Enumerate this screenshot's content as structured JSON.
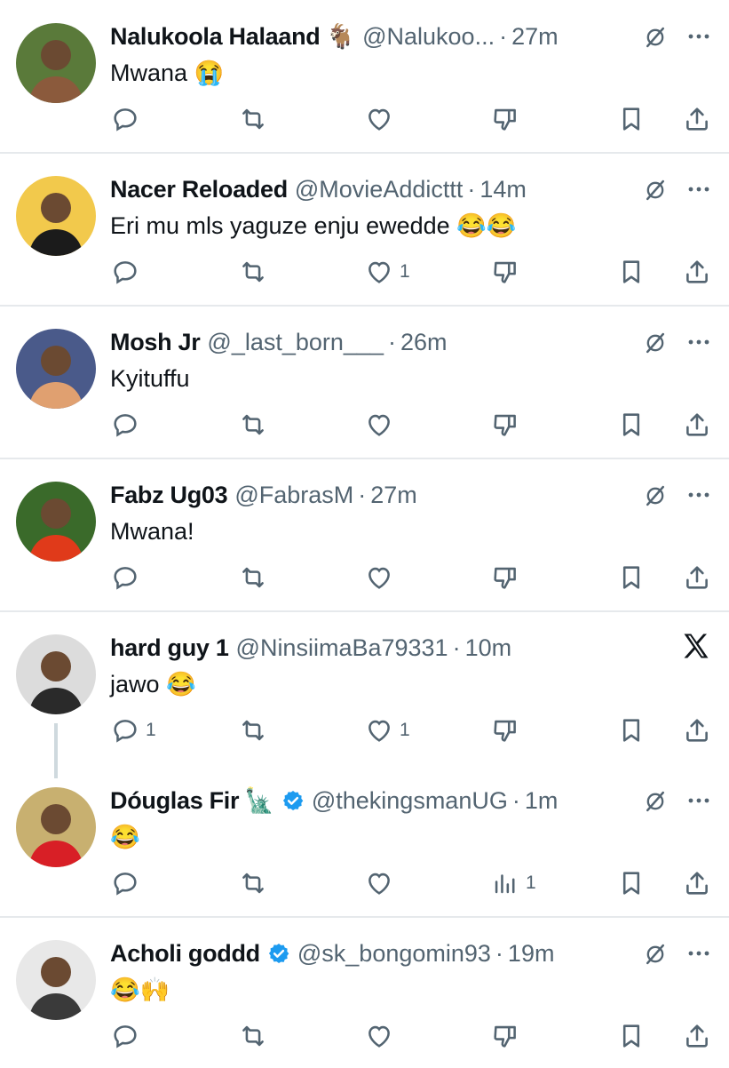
{
  "tweets": [
    {
      "name": "Nalukoola Halaand",
      "name_emoji": "🐐",
      "handle": "@Nalukoo...",
      "sep": "·",
      "time": "27m",
      "text": "Mwana 😭",
      "verified": false,
      "likes": "",
      "replies": "",
      "stat_icon": "dislike-icon",
      "stat_count": "",
      "top_right": "grok"
    },
    {
      "name": "Nacer Reloaded",
      "name_emoji": "",
      "handle": "@MovieAddicttt",
      "sep": "·",
      "time": "14m",
      "text": "Eri mu mls yaguze enju ewedde 😂😂",
      "verified": false,
      "likes": "1",
      "replies": "",
      "stat_icon": "dislike-icon",
      "stat_count": "",
      "top_right": "grok"
    },
    {
      "name": "Mosh Jr",
      "name_emoji": "",
      "handle": "@_last_born___",
      "sep": "·",
      "time": "26m",
      "text": "Kyituffu",
      "verified": false,
      "likes": "",
      "replies": "",
      "stat_icon": "dislike-icon",
      "stat_count": "",
      "top_right": "grok"
    },
    {
      "name": "Fabz Ug03",
      "name_emoji": "",
      "handle": "@FabrasM",
      "sep": "·",
      "time": "27m",
      "text": "Mwana!",
      "verified": false,
      "likes": "",
      "replies": "",
      "stat_icon": "dislike-icon",
      "stat_count": "",
      "top_right": "grok"
    },
    {
      "name": "hard guy 1",
      "name_emoji": "",
      "handle": "@NinsiimaBa79331",
      "sep": "·",
      "time": "10m",
      "text": "jawo 😂",
      "verified": false,
      "likes": "1",
      "replies": "1",
      "stat_icon": "dislike-icon",
      "stat_count": "",
      "top_right": "x"
    },
    {
      "name": "Dóuglas Fir",
      "name_emoji": "🗽",
      "handle": "@thekingsmanUG",
      "sep": "·",
      "time": "1m",
      "text": "😂",
      "verified": true,
      "likes": "",
      "replies": "",
      "stat_icon": "views-icon",
      "stat_count": "1",
      "top_right": "grok"
    },
    {
      "name": "Acholi goddd",
      "name_emoji": "",
      "handle": "@sk_bongomin93",
      "sep": "·",
      "time": "19m",
      "text": "😂🙌",
      "verified": true,
      "likes": "",
      "replies": "",
      "stat_icon": "dislike-icon",
      "stat_count": "",
      "top_right": "grok"
    }
  ],
  "colors": {
    "text": "#0f1419",
    "secondary": "#536471",
    "divider": "#e6e9ec",
    "verified": "#1d9bf0",
    "thread": "#cfd9de"
  },
  "icons": [
    "reply-icon",
    "retweet-icon",
    "like-icon",
    "dislike-icon",
    "views-icon",
    "bookmark-icon",
    "share-icon",
    "grok-icon",
    "more-icon",
    "x-logo-icon",
    "verified-badge-icon"
  ]
}
